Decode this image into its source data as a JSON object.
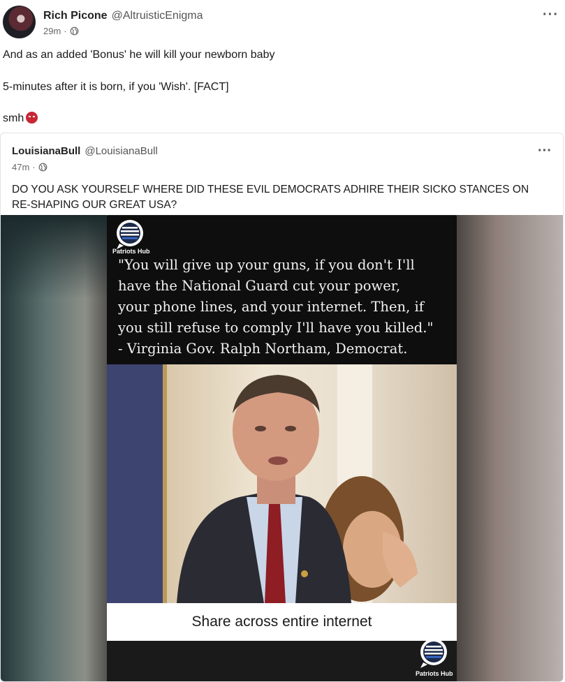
{
  "post": {
    "author_name": "Rich Picone",
    "author_handle": "@AltruisticEnigma",
    "time": "29m",
    "meta_sep": "·",
    "more": "···",
    "lines": [
      "And as an added 'Bonus' he will kill your newborn baby",
      "5-minutes after it is born, if you 'Wish'. [FACT]",
      "smh"
    ]
  },
  "quoted_post": {
    "author_name": "LouisianaBull",
    "author_handle": "@LouisianaBull",
    "time": "47m",
    "meta_sep": "·",
    "more": "···",
    "text": "DO YOU ASK YOURSELF WHERE DID THESE EVIL DEMOCRATS ADHIRE THEIR SICKO STANCES ON RE-SHAPING OUR GREAT USA?",
    "image": {
      "logo_label": "Patriots Hub",
      "quote_lines": [
        "\"You will give up your guns, if you don't I'll",
        "have the National Guard cut your power,",
        "your phone lines, and your internet. Then, if",
        "you still refuse to comply I'll have you killed.\"",
        "- Virginia Gov. Ralph Northam, Democrat."
      ],
      "caption": "Share across entire internet"
    }
  },
  "icons": [
    "globe-icon",
    "more-icon",
    "angry-face-icon",
    "patriots-hub-logo"
  ],
  "colors": {
    "accent_red": "#c72735",
    "text": "#1a1a1a",
    "muted": "#666666"
  }
}
